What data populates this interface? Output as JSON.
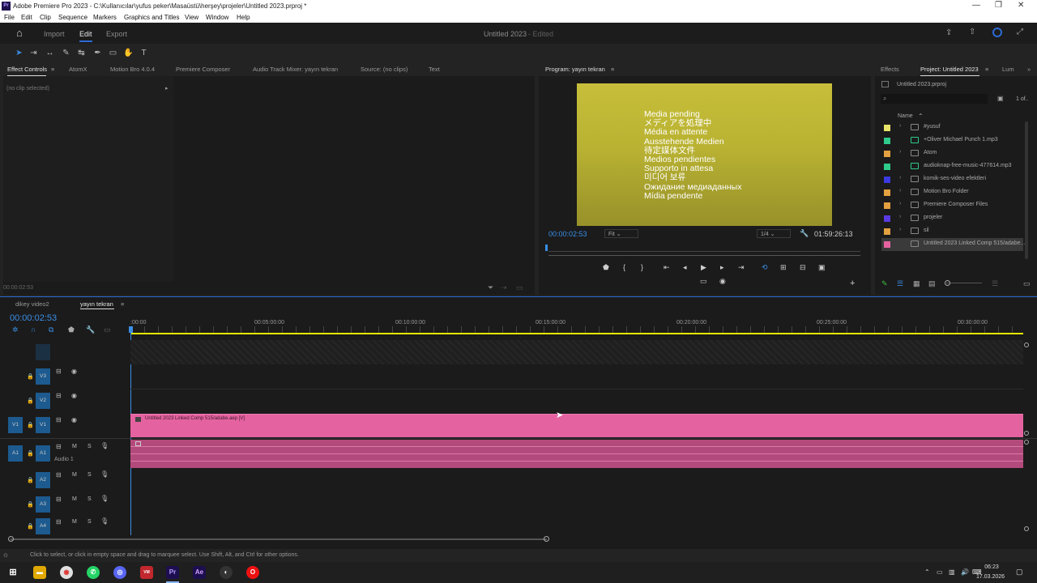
{
  "window": {
    "title": "Adobe Premiere Pro 2023 - C:\\Kullanıcılar\\yufus peker\\Masaüstü\\herşey\\projeler\\Untitled 2023.prproj *",
    "app_badge": "Pr"
  },
  "menu": [
    "File",
    "Edit",
    "Clip",
    "Sequence",
    "Markers",
    "Graphics and Titles",
    "View",
    "Window",
    "Help"
  ],
  "header": {
    "tabs": [
      "Import",
      "Edit",
      "Export"
    ],
    "project_name": "Untitled 2023",
    "edited": "- Edited"
  },
  "left_panel": {
    "tabs": [
      "Effect Controls",
      "AtomX",
      "Motion Bro 4.0.4",
      "Premiere Composer",
      "Audio Track Mixer: yayın tekran",
      "Source: (no clips)",
      "Text"
    ],
    "no_clip": "(no clip selected)",
    "timecode": "00:00:02:53"
  },
  "program": {
    "title": "Program: yayın tekran",
    "media_pending": [
      "Media pending",
      "メディアを処理中",
      "Média en attente",
      "Ausstehende Medien",
      "待定媒体文件",
      "Medios pendientes",
      "Supporto in attesa",
      "미디어 보류",
      "Ожидание медиаданных",
      "Mídia pendente"
    ],
    "timecode": "00:00:02:53",
    "fit": "Fit",
    "ratio": "1/4",
    "duration": "01:59:26:13"
  },
  "project": {
    "tabs": [
      "Effects",
      "Project: Untitled 2023",
      "Lum"
    ],
    "file": "Untitled 2023.prproj",
    "count": "1 of..",
    "col_name": "Name",
    "items": [
      {
        "name": "#yusuf",
        "color": "#e8e36a",
        "type": "folder"
      },
      {
        "name": "+Oliver Michael   Punch 1.mp3",
        "color": "#2ecb8a",
        "type": "audio"
      },
      {
        "name": "Atom",
        "color": "#e3a040",
        "type": "folder"
      },
      {
        "name": "audioknap-free-music-477614.mp3",
        "color": "#2ecb8a",
        "type": "audio"
      },
      {
        "name": "komik-ses-video efektleri",
        "color": "#3a3ae0",
        "type": "folder"
      },
      {
        "name": "Motion Bro Folder",
        "color": "#e3a040",
        "type": "folder"
      },
      {
        "name": "Premiere Composer Files",
        "color": "#e3a040",
        "type": "folder"
      },
      {
        "name": "projeler",
        "color": "#5a3ae0",
        "type": "folder"
      },
      {
        "name": "sil",
        "color": "#e3a040",
        "type": "folder"
      },
      {
        "name": "Untitled 2023 Linked Comp 515/adabe...",
        "color": "#e562a0",
        "type": "comp"
      }
    ]
  },
  "timeline": {
    "tabs": [
      "dikey video2",
      "yayın tekran"
    ],
    "timecode": "00:00:02:53",
    "ruler": [
      ":00:00",
      "00:05:00:00",
      "00:10:00:00",
      "00:15:00:00",
      "00:20:00:00",
      "00:25:00:00",
      "00:30:00:00"
    ],
    "video_tracks": [
      "V3",
      "V2",
      "V1"
    ],
    "audio_tracks": [
      "A1",
      "A2",
      "A3",
      "A4"
    ],
    "audio1_label": "Audio 1",
    "src_v": "V1",
    "src_a": "A1",
    "clip": "Untitled 2023 Linked Comp 515/adabe.aep [V]",
    "track_btns": [
      "M",
      "S"
    ]
  },
  "status": "Click to select, or click in empty space and drag to marquee select. Use Shift, Alt, and Ctrl for other options.",
  "taskbar": {
    "time": "06:23",
    "date": "17.03.2026"
  },
  "colors": {
    "accent": "#2d6ad4",
    "clip_video": "#e562a0",
    "clip_audio": "#b34a7c",
    "playhead": "#e6e600"
  }
}
